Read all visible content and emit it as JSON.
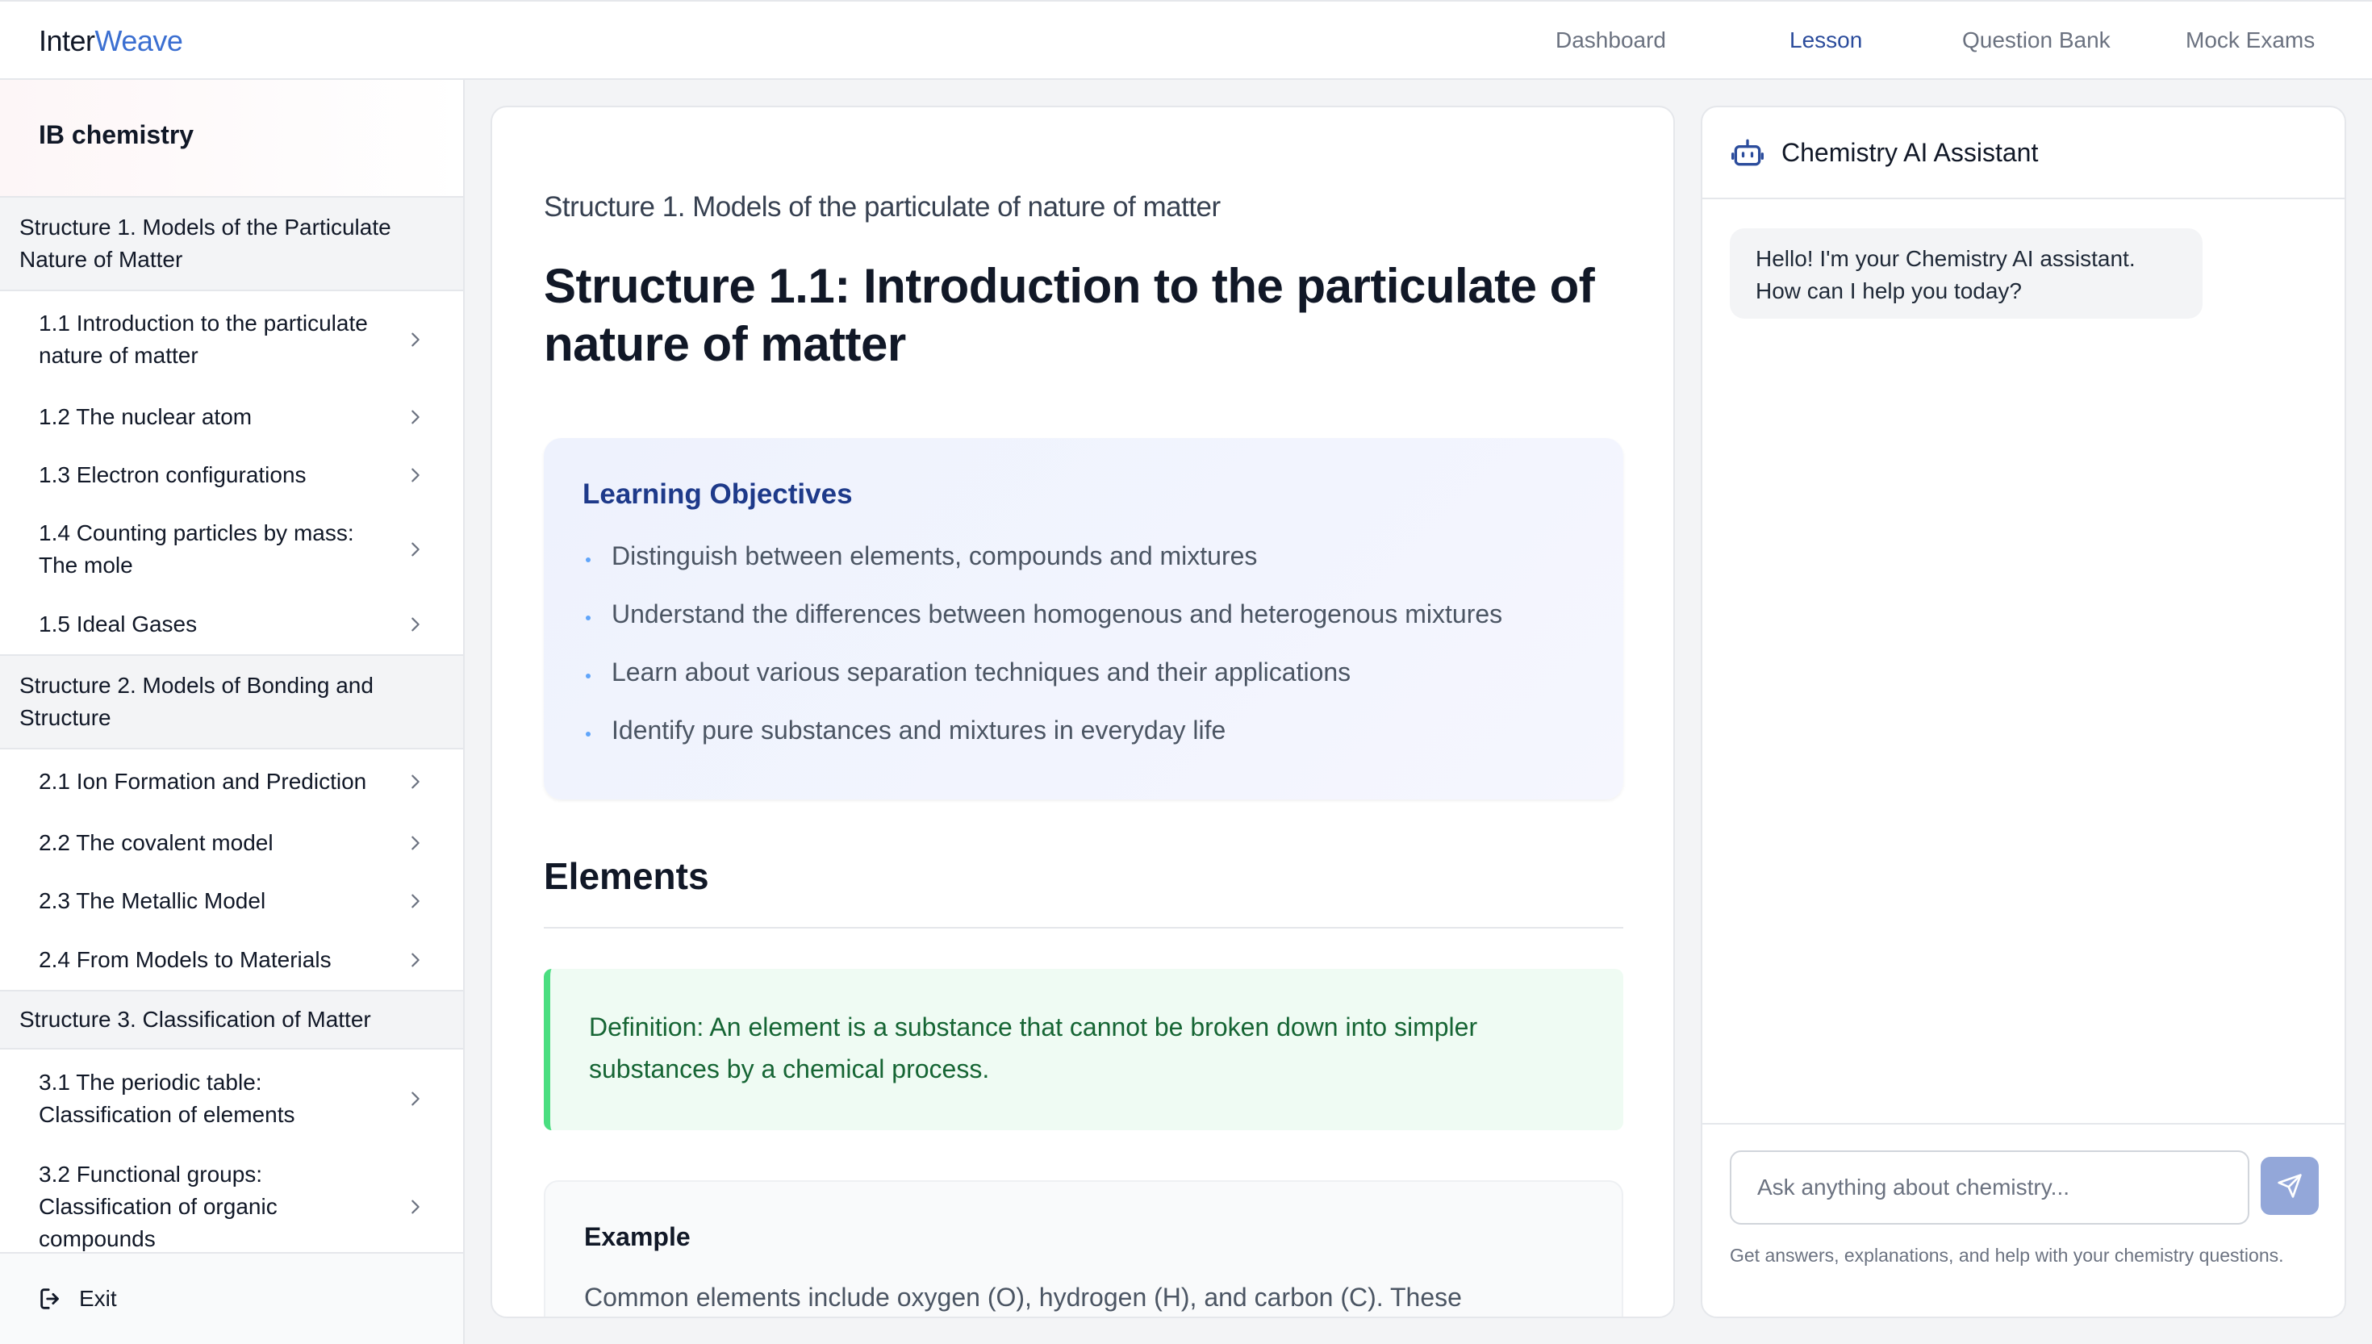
{
  "brand": {
    "part1": "Inter",
    "part2": "Weave"
  },
  "nav": {
    "items": [
      {
        "label": "Dashboard",
        "active": false
      },
      {
        "label": "Lesson",
        "active": true
      },
      {
        "label": "Question Bank",
        "active": false
      },
      {
        "label": "Mock Exams",
        "active": false
      }
    ]
  },
  "sidebar": {
    "course_title": "IB chemistry",
    "chapters": [
      {
        "title": "Structure 1. Models of the Particulate Nature of Matter",
        "lessons": [
          "1.1 Introduction to the particulate nature of matter",
          "1.2 The nuclear atom",
          "1.3 Electron configurations",
          "1.4 Counting particles by mass: The mole",
          "1.5 Ideal Gases"
        ]
      },
      {
        "title": "Structure 2. Models of Bonding and Structure",
        "lessons": [
          "2.1 Ion Formation and Prediction",
          "2.2 The covalent model",
          "2.3 The Metallic Model",
          "2.4 From Models to Materials"
        ]
      },
      {
        "title": "Structure 3. Classification of Matter",
        "lessons": [
          "3.1 The periodic table: Classification of elements",
          "3.2 Functional groups: Classification of organic compounds"
        ]
      }
    ],
    "exit_label": "Exit"
  },
  "lesson": {
    "subtitle": "Structure 1. Models of the particulate of nature of matter",
    "title": "Structure 1.1: Introduction to the particulate of nature of matter",
    "objectives": {
      "heading": "Learning Objectives",
      "items": [
        "Distinguish between elements, compounds and mixtures",
        "Understand the differences between homogenous and heterogenous mixtures",
        "Learn about various separation techniques and their applications",
        "Identify pure substances and mixtures in everyday life"
      ]
    },
    "section_heading": "Elements",
    "definition": "Definition: An element is a substance that cannot be broken down into simpler substances by a chemical process.",
    "example": {
      "heading": "Example",
      "text": "Common elements include oxygen (O), hydrogen (H), and carbon (C). These"
    }
  },
  "assistant": {
    "title": "Chemistry AI Assistant",
    "greeting": "Hello! I'm your Chemistry AI assistant. How can I help you today?",
    "input_placeholder": "Ask anything about chemistry...",
    "helper_text": "Get answers, explanations, and help with your chemistry questions."
  },
  "colors": {
    "brand_accent": "#3b6fd1",
    "nav_active": "#2b4c9c",
    "objectives_heading": "#1e3a8a",
    "definition_text": "#166534",
    "definition_border": "#4ade80",
    "send_button": "#93a7d9"
  }
}
